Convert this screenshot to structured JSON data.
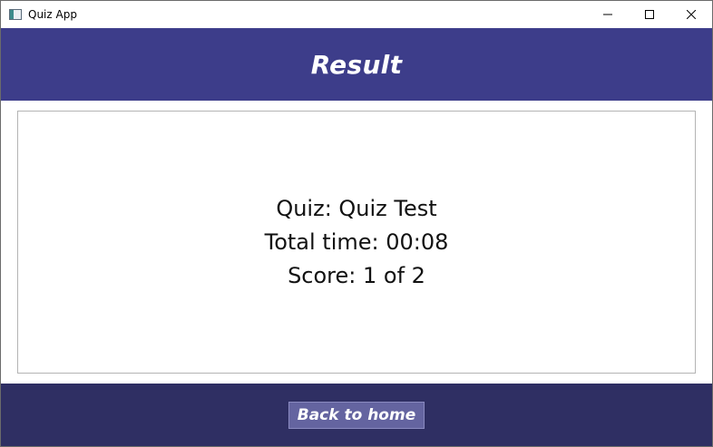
{
  "window": {
    "title": "Quiz App",
    "controls": {
      "minimize_icon": "minimize-icon",
      "maximize_icon": "maximize-icon",
      "close_icon": "close-icon"
    }
  },
  "header": {
    "title": "Result",
    "background": "#3d3d8a"
  },
  "result": {
    "quiz_line": "Quiz: Quiz Test",
    "time_line": "Total time: 00:08",
    "score_line": "Score: 1 of 2"
  },
  "footer": {
    "back_button_label": "Back to home",
    "background": "#2f2f63",
    "button_color": "#6464a0"
  }
}
